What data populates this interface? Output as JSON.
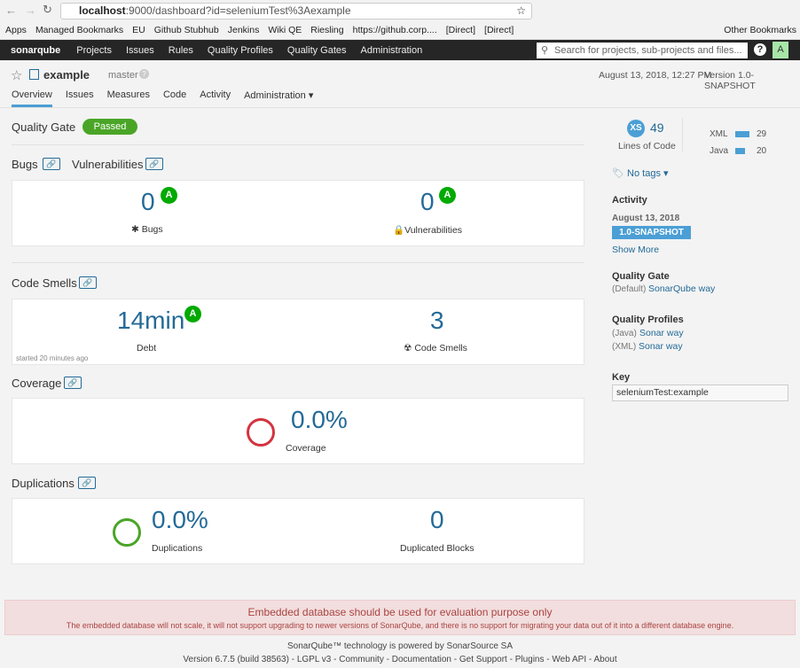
{
  "browser": {
    "url_host": "localhost",
    "url_rest": ":9000/dashboard?id=seleniumTest%3Aexample",
    "bookmarks": [
      "Apps",
      "Managed Bookmarks",
      "EU",
      "Github Stubhub",
      "Jenkins",
      "Wiki QE",
      "Riesling",
      "https://github.corp....",
      "[Direct]",
      "[Direct]"
    ],
    "other_bookmarks": "Other Bookmarks"
  },
  "nav": {
    "logo": "sonarqube",
    "items": [
      "Projects",
      "Issues",
      "Rules",
      "Quality Profiles",
      "Quality Gates",
      "Administration"
    ],
    "search_placeholder": "Search for projects, sub-projects and files...",
    "help": "?",
    "avatar": "A"
  },
  "project": {
    "name": "example",
    "branch": "master",
    "date": "August 13, 2018, 12:27 PM",
    "version": "Version 1.0-SNAPSHOT",
    "tabs": [
      "Overview",
      "Issues",
      "Measures",
      "Code",
      "Activity",
      "Administration ▾"
    ]
  },
  "quality_gate": {
    "label": "Quality Gate",
    "status": "Passed",
    "color": "#4aa527"
  },
  "bugs": {
    "title1": "Bugs",
    "title2": "Vulnerabilities",
    "bugs": "0",
    "bugs_label": "Bugs",
    "bugs_rating": "A",
    "vulns": "0",
    "vulns_label": "Vulnerabilities",
    "vulns_rating": "A"
  },
  "smells": {
    "title": "Code Smells",
    "debt": "14min",
    "debt_label": "Debt",
    "debt_rating": "A",
    "count": "3",
    "count_label": "Code Smells",
    "started": "started 20 minutes ago"
  },
  "coverage": {
    "title": "Coverage",
    "value": "0.0%",
    "label": "Coverage"
  },
  "duplications": {
    "title": "Duplications",
    "value": "0.0%",
    "label": "Duplications",
    "blocks": "0",
    "blocks_label": "Duplicated Blocks"
  },
  "sidebar": {
    "size": "XS",
    "loc": "49",
    "loc_label": "Lines of Code",
    "languages": [
      {
        "name": "XML",
        "value": 29
      },
      {
        "name": "Java",
        "value": 20
      }
    ],
    "tags": "No tags ▾",
    "activity_title": "Activity",
    "activity_date": "August 13, 2018",
    "activity_version": "1.0-SNAPSHOT",
    "show_more": "Show More",
    "qg_title": "Quality Gate",
    "qg_default": "(Default)",
    "qg_name": "SonarQube way",
    "qp_title": "Quality Profiles",
    "qp": [
      {
        "lang": "(Java)",
        "name": "Sonar way"
      },
      {
        "lang": "(XML)",
        "name": "Sonar way"
      }
    ],
    "key_title": "Key",
    "key": "seleniumTest:example"
  },
  "warning": {
    "title": "Embedded database should be used for evaluation purpose only",
    "text": "The embedded database will not scale, it will not support upgrading to newer versions of SonarQube, and there is no support for migrating your data out of it into a different database engine."
  },
  "footer": {
    "powered": "SonarQube™ technology is powered by ",
    "company": "SonarSource SA",
    "version": "Version 6.7.5 (build 38563) - ",
    "links": [
      "LGPL v3",
      "Community",
      "Documentation",
      "Get Support",
      "Plugins",
      "Web API",
      "About"
    ]
  }
}
